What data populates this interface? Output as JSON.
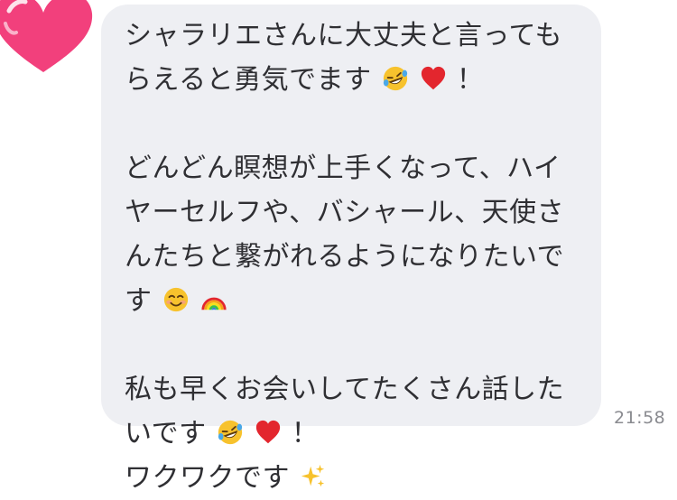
{
  "chat": {
    "message": {
      "line1": "シャラリエさんに大丈夫と言っても",
      "line2": "らえると勇気でます",
      "line2_end": "！",
      "line3": "どんどん瞑想が上手くなって、ハイ",
      "line4": "ヤーセルフや、バシャール、天使さ",
      "line5": "んたちと繋がれるようになりたいで",
      "line6": "す",
      "line7": "私も早くお会いしてたくさん話した",
      "line8": "いです",
      "line8_end": "！",
      "line9": "ワクワクです"
    },
    "timestamp": "21:58",
    "emoji_names": [
      "rofl-emoji",
      "red-heart-emoji",
      "smiling-face-emoji",
      "rainbow-emoji",
      "sparkles-emoji"
    ],
    "colors": {
      "bubble": "#eeeff3",
      "text": "#2f2f33",
      "timestamp": "#8a8b90",
      "avatar_heart": "#f2407c"
    }
  }
}
